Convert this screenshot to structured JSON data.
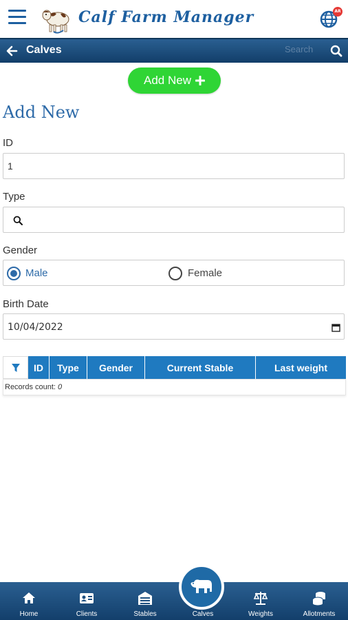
{
  "header": {
    "app_title": "Calf Farm Manager",
    "badge": "AR"
  },
  "navbar": {
    "title": "Calves",
    "search_placeholder": "Search"
  },
  "add_button": {
    "label": "Add New"
  },
  "form": {
    "section_title": "Add New",
    "id_label": "ID",
    "id_value": "1",
    "type_label": "Type",
    "gender_label": "Gender",
    "gender_options": [
      "Male",
      "Female"
    ],
    "gender_selected": "Male",
    "birth_date_label": "Birth Date",
    "birth_date_value": "10/04/2022"
  },
  "table": {
    "columns": [
      "ID",
      "Type",
      "Gender",
      "Current Stable",
      "Last weight"
    ],
    "records_label": "Records count:",
    "records_count": "0"
  },
  "bottom_nav": {
    "items": [
      "Home",
      "Clients",
      "Stables",
      "Calves",
      "Weights",
      "Allotments"
    ],
    "active": "Calves"
  },
  "colors": {
    "accent": "#1d5fa0",
    "add_button": "#2fd535",
    "table_header": "#1f7ac0"
  }
}
